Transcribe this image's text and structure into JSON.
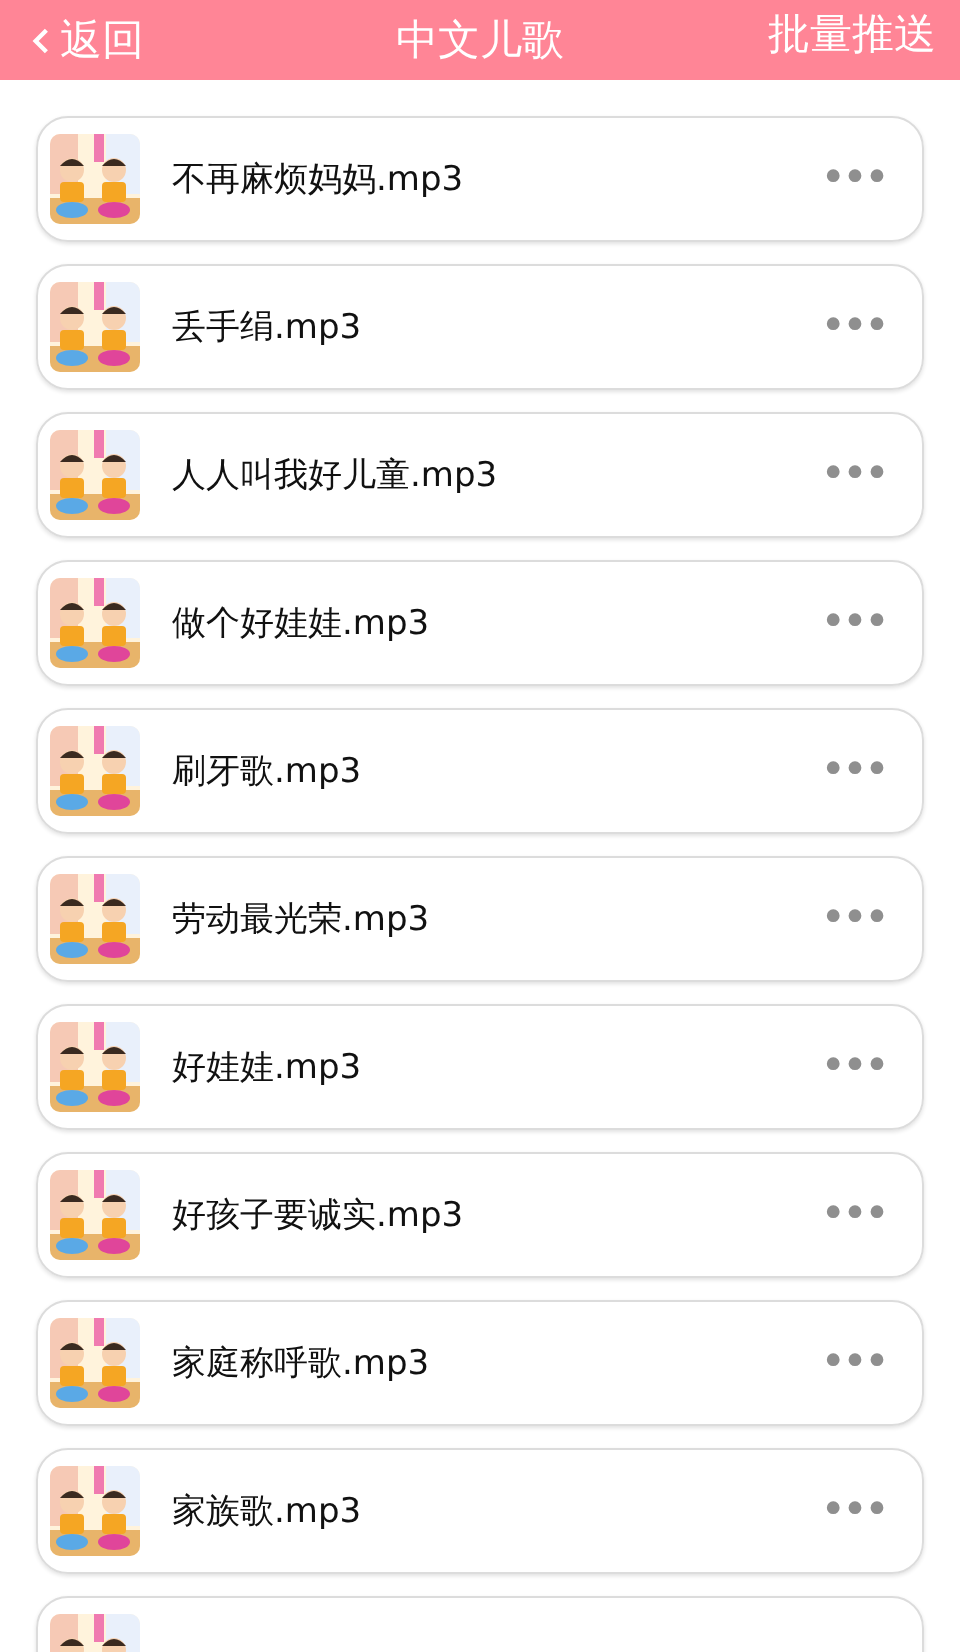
{
  "header": {
    "back": "返回",
    "title": "中文儿歌",
    "action": "批量推送"
  },
  "songs": [
    {
      "title": "不再麻烦妈妈.mp3",
      "more": "•••"
    },
    {
      "title": "丢手绢.mp3",
      "more": "•••"
    },
    {
      "title": "人人叫我好儿童.mp3",
      "more": "•••"
    },
    {
      "title": "做个好娃娃.mp3",
      "more": "•••"
    },
    {
      "title": "刷牙歌.mp3",
      "more": "•••"
    },
    {
      "title": "劳动最光荣.mp3",
      "more": "•••"
    },
    {
      "title": "好娃娃.mp3",
      "more": "•••"
    },
    {
      "title": "好孩子要诚实.mp3",
      "more": "•••"
    },
    {
      "title": "家庭称呼歌.mp3",
      "more": "•••"
    },
    {
      "title": "家族歌.mp3",
      "more": "•••"
    },
    {
      "kind": "picture"
    }
  ]
}
